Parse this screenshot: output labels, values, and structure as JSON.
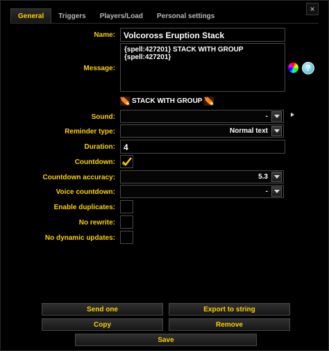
{
  "window": {
    "close_glyph": "×"
  },
  "tabs": [
    {
      "label": "General",
      "active": true
    },
    {
      "label": "Triggers",
      "active": false
    },
    {
      "label": "Players/Load",
      "active": false
    },
    {
      "label": "Personal settings",
      "active": false
    }
  ],
  "form": {
    "name_label": "Name:",
    "name_value": "Volcoross Eruption Stack",
    "message_label": "Message:",
    "message_line1": "{spell:427201} STACK WITH GROUP",
    "message_line2": "{spell:427201}",
    "preview_text": "STACK WITH GROUP",
    "sound_label": "Sound:",
    "sound_value": "-",
    "reminder_type_label": "Reminder type:",
    "reminder_type_value": "Normal text",
    "duration_label": "Duration:",
    "duration_value": "4",
    "countdown_label": "Countdown:",
    "countdown_checked": true,
    "countdown_accuracy_label": "Countdown accuracy:",
    "countdown_accuracy_value": "5.3",
    "voice_countdown_label": "Voice countdown:",
    "voice_countdown_value": "-",
    "enable_duplicates_label": "Enable duplicates:",
    "enable_duplicates_checked": false,
    "no_rewrite_label": "No rewrite:",
    "no_rewrite_checked": false,
    "no_dynamic_updates_label": "No dynamic updates:",
    "no_dynamic_updates_checked": false
  },
  "actions": {
    "send_one": "Send one",
    "export": "Export to string",
    "copy": "Copy",
    "remove": "Remove",
    "save": "Save"
  },
  "colors": {
    "accent": "#ffd100",
    "background": "#000000",
    "border": "#4a4a4a"
  },
  "icons": [
    "close-icon",
    "color-picker-icon",
    "help-icon",
    "play-sound-icon",
    "spell-icon",
    "checkmark-icon"
  ]
}
